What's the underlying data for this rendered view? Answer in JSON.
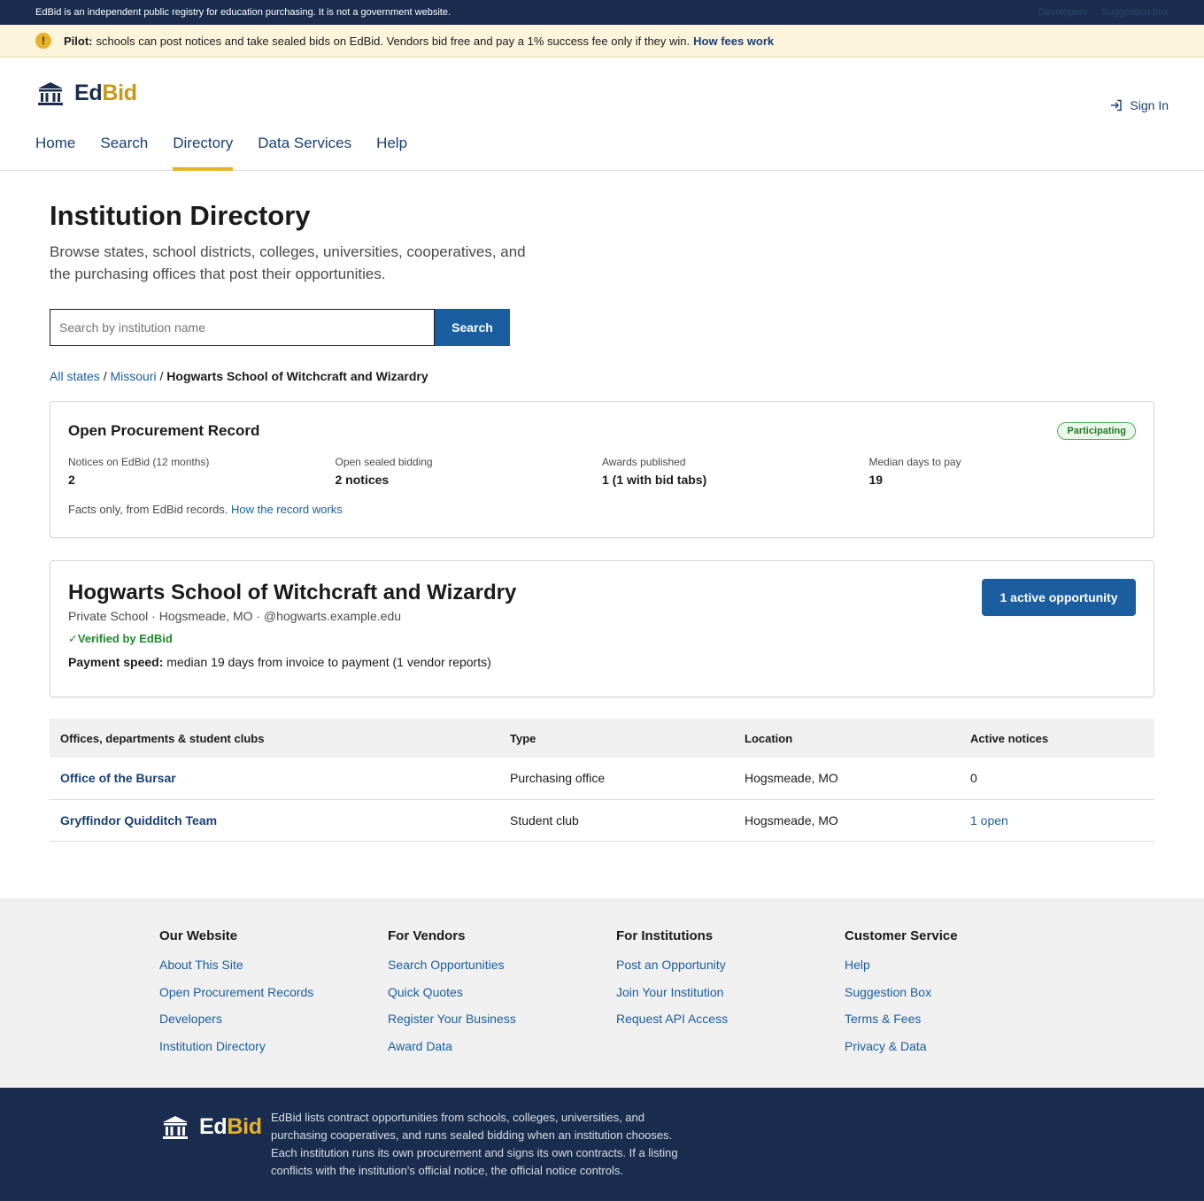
{
  "topbar": {
    "notice": "EdBid is an independent public registry for education purchasing. It is not a government website.",
    "links": [
      "Developers",
      "Suggestion box"
    ]
  },
  "pilot": {
    "icon": "exclamation-icon",
    "label": "Pilot:",
    "text": "schools can post notices and take sealed bids on EdBid. Vendors bid free and pay a 1% success fee only if they win.",
    "link": "How fees work"
  },
  "header": {
    "logo_ed": "Ed",
    "logo_bid": "Bid",
    "signin": "Sign In",
    "nav": [
      "Home",
      "Search",
      "Directory",
      "Data Services",
      "Help"
    ],
    "active_nav": "Directory"
  },
  "main": {
    "title": "Institution Directory",
    "description": "Browse states, school districts, colleges, universities, cooperatives, and the purchasing offices that post their opportunities.",
    "search": {
      "placeholder": "Search by institution name",
      "value": "",
      "button": "Search"
    },
    "breadcrumb": {
      "items": [
        "All states",
        "Missouri"
      ],
      "separator": "/",
      "current": "Hogwarts School of Witchcraft and Wizardry"
    }
  },
  "record": {
    "title": "Open Procurement Record",
    "badge": "Participating",
    "stats": [
      {
        "label": "Notices on EdBid (12 months)",
        "value": "2"
      },
      {
        "label": "Open sealed bidding",
        "value": "2 notices"
      },
      {
        "label": "Awards published",
        "value": "1 (1 with bid tabs)"
      },
      {
        "label": "Median days to pay",
        "value": "19"
      }
    ],
    "note": "Facts only, from EdBid records.",
    "note_link": "How the record works"
  },
  "institution": {
    "name": "Hogwarts School of Witchcraft and Wizardry",
    "meta": "Private School · Hogsmeade, MO · @hogwarts.example.edu",
    "verified": "✓Verified by EdBid",
    "payment_label": "Payment speed:",
    "payment_text": "median 19 days from invoice to payment (1 vendor reports)",
    "active_button": "1 active opportunity"
  },
  "offices": {
    "headers": [
      "Offices, departments & student clubs",
      "Type",
      "Location",
      "Active notices"
    ],
    "rows": [
      {
        "name": "Office of the Bursar",
        "type": "Purchasing office",
        "location": "Hogsmeade, MO",
        "active": "0"
      },
      {
        "name": "Gryffindor Quidditch Team",
        "type": "Student club",
        "location": "Hogsmeade, MO",
        "active": "1 open"
      }
    ]
  },
  "footer": {
    "columns": [
      {
        "title": "Our Website",
        "items": [
          "About This Site",
          "Open Procurement Records",
          "Developers",
          "Institution Directory"
        ]
      },
      {
        "title": "For Vendors",
        "items": [
          "Search Opportunities",
          "Quick Quotes",
          "Register Your Business",
          "Award Data"
        ]
      },
      {
        "title": "For Institutions",
        "items": [
          "Post an Opportunity",
          "Join Your Institution",
          "Request API Access"
        ]
      },
      {
        "title": "Customer Service",
        "items": [
          "Help",
          "Suggestion Box",
          "Terms & Fees",
          "Privacy & Data"
        ]
      }
    ],
    "logo_ed": "Ed",
    "logo_bid": "Bid",
    "description": "EdBid lists contract opportunities from schools, colleges, universities, and purchasing cooperatives, and runs sealed bidding when an institution chooses. Each institution runs its own procurement and signs its own contracts. If a listing conflicts with the institution's official notice, the official notice controls."
  },
  "colors": {
    "navy": "#1a2d4f",
    "link_blue": "#1a5ea0",
    "gold": "#c9971a",
    "banner_bg": "#fdf4dc",
    "success_green": "#1f8a2c"
  }
}
